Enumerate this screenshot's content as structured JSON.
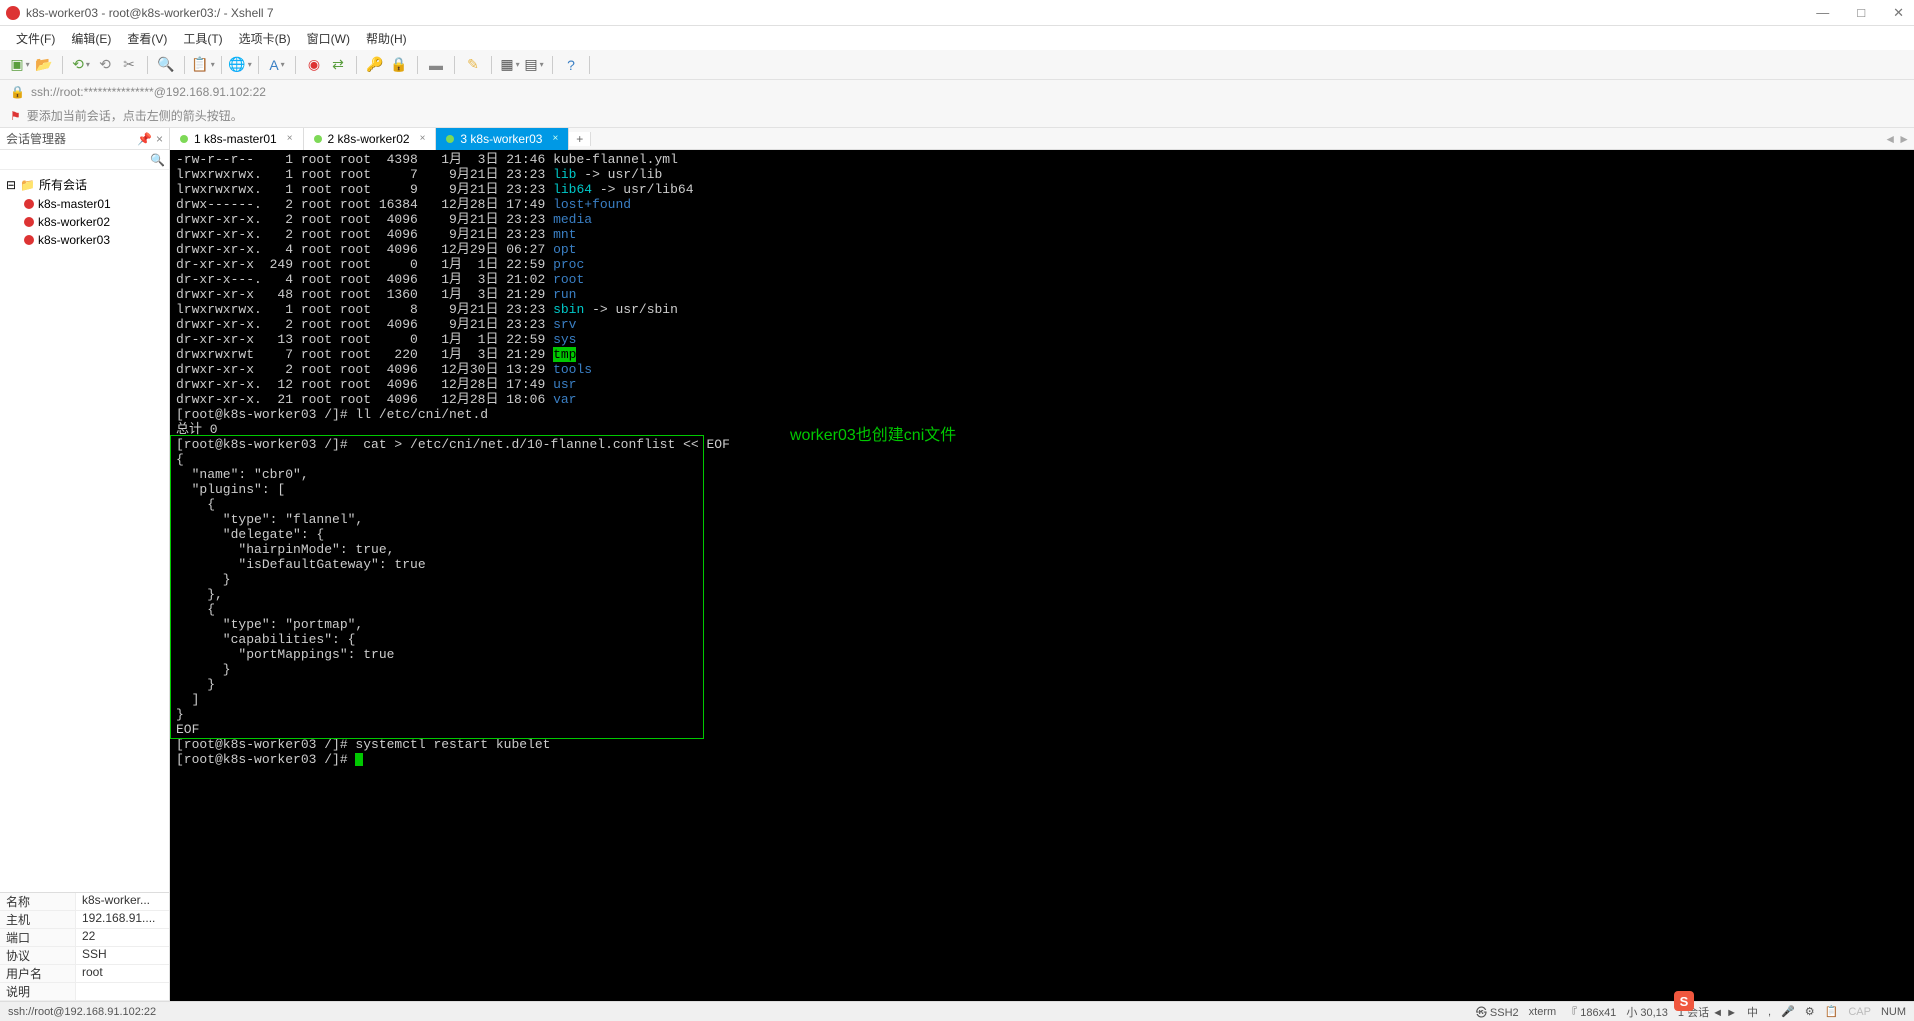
{
  "window": {
    "title": "k8s-worker03 - root@k8s-worker03:/ - Xshell 7",
    "min": "—",
    "max": "□",
    "close": "✕"
  },
  "menus": [
    "文件(F)",
    "编辑(E)",
    "查看(V)",
    "工具(T)",
    "选项卡(B)",
    "窗口(W)",
    "帮助(H)"
  ],
  "address": "ssh://root:***************@192.168.91.102:22",
  "hint": "要添加当前会话，点击左侧的箭头按钮。",
  "sidebar": {
    "title": "会话管理器",
    "root": "所有会话",
    "hosts": [
      "k8s-master01",
      "k8s-worker02",
      "k8s-worker03"
    ]
  },
  "props": [
    {
      "k": "名称",
      "v": "k8s-worker..."
    },
    {
      "k": "主机",
      "v": "192.168.91...."
    },
    {
      "k": "端口",
      "v": "22"
    },
    {
      "k": "协议",
      "v": "SSH"
    },
    {
      "k": "用户名",
      "v": "root"
    },
    {
      "k": "说明",
      "v": ""
    }
  ],
  "tabs": [
    {
      "num": "1",
      "label": "k8s-master01",
      "active": false
    },
    {
      "num": "2",
      "label": "k8s-worker02",
      "active": false
    },
    {
      "num": "3",
      "label": "k8s-worker03",
      "active": true
    }
  ],
  "annotation": "worker03也创建cni文件",
  "terminal": {
    "ls": [
      {
        "perm": "-rw-r--r--",
        "n": "1",
        "u": "root",
        "g": "root",
        "s": "4398",
        "d": "1月  3日 21:46",
        "name": "kube-flannel.yml",
        "col": "w"
      },
      {
        "perm": "lrwxrwxrwx.",
        "n": "1",
        "u": "root",
        "g": "root",
        "s": "7",
        "d": "9月21日 23:23",
        "name": "lib",
        "link": " -> usr/lib",
        "col": "c"
      },
      {
        "perm": "lrwxrwxrwx.",
        "n": "1",
        "u": "root",
        "g": "root",
        "s": "9",
        "d": "9月21日 23:23",
        "name": "lib64",
        "link": " -> usr/lib64",
        "col": "c"
      },
      {
        "perm": "drwx------.",
        "n": "2",
        "u": "root",
        "g": "root",
        "s": "16384",
        "d": "12月28日 17:49",
        "name": "lost+found",
        "col": "b"
      },
      {
        "perm": "drwxr-xr-x.",
        "n": "2",
        "u": "root",
        "g": "root",
        "s": "4096",
        "d": "9月21日 23:23",
        "name": "media",
        "col": "b"
      },
      {
        "perm": "drwxr-xr-x.",
        "n": "2",
        "u": "root",
        "g": "root",
        "s": "4096",
        "d": "9月21日 23:23",
        "name": "mnt",
        "col": "b"
      },
      {
        "perm": "drwxr-xr-x.",
        "n": "4",
        "u": "root",
        "g": "root",
        "s": "4096",
        "d": "12月29日 06:27",
        "name": "opt",
        "col": "b"
      },
      {
        "perm": "dr-xr-xr-x",
        "n": "249",
        "u": "root",
        "g": "root",
        "s": "0",
        "d": "1月  1日 22:59",
        "name": "proc",
        "col": "b"
      },
      {
        "perm": "dr-xr-x---.",
        "n": "4",
        "u": "root",
        "g": "root",
        "s": "4096",
        "d": "1月  3日 21:02",
        "name": "root",
        "col": "b"
      },
      {
        "perm": "drwxr-xr-x",
        "n": "48",
        "u": "root",
        "g": "root",
        "s": "1360",
        "d": "1月  3日 21:29",
        "name": "run",
        "col": "b"
      },
      {
        "perm": "lrwxrwxrwx.",
        "n": "1",
        "u": "root",
        "g": "root",
        "s": "8",
        "d": "9月21日 23:23",
        "name": "sbin",
        "link": " -> usr/sbin",
        "col": "c"
      },
      {
        "perm": "drwxr-xr-x.",
        "n": "2",
        "u": "root",
        "g": "root",
        "s": "4096",
        "d": "9月21日 23:23",
        "name": "srv",
        "col": "b"
      },
      {
        "perm": "dr-xr-xr-x",
        "n": "13",
        "u": "root",
        "g": "root",
        "s": "0",
        "d": "1月  1日 22:59",
        "name": "sys",
        "col": "b"
      },
      {
        "perm": "drwxrwxrwt",
        "n": "7",
        "u": "root",
        "g": "root",
        "s": "220",
        "d": "1月  3日 21:29",
        "name": "tmp",
        "col": "bg"
      },
      {
        "perm": "drwxr-xr-x",
        "n": "2",
        "u": "root",
        "g": "root",
        "s": "4096",
        "d": "12月30日 13:29",
        "name": "tools",
        "col": "b"
      },
      {
        "perm": "drwxr-xr-x.",
        "n": "12",
        "u": "root",
        "g": "root",
        "s": "4096",
        "d": "12月28日 17:49",
        "name": "usr",
        "col": "b"
      },
      {
        "perm": "drwxr-xr-x.",
        "n": "21",
        "u": "root",
        "g": "root",
        "s": "4096",
        "d": "12月28日 18:06",
        "name": "var",
        "col": "b"
      }
    ],
    "cmd1": "[root@k8s-worker03 /]# ll /etc/cni/net.d",
    "total": "总计 0",
    "cmd2": "[root@k8s-worker03 /]#  cat > /etc/cni/net.d/10-flannel.conflist << EOF",
    "body": "{\n  \"name\": \"cbr0\",\n  \"plugins\": [\n    {\n      \"type\": \"flannel\",\n      \"delegate\": {\n        \"hairpinMode\": true,\n        \"isDefaultGateway\": true\n      }\n    },\n    {\n      \"type\": \"portmap\",\n      \"capabilities\": {\n        \"portMappings\": true\n      }\n    }\n  ]\n}\nEOF",
    "cmd3": "[root@k8s-worker03 /]# systemctl restart kubelet",
    "cmd4": "[root@k8s-worker03 /]# "
  },
  "status": {
    "left": "ssh://root@192.168.91.102:22",
    "items": [
      "㉿ SSH2",
      "xterm",
      "『 186x41",
      "小 30,13",
      "1 会话 ◄ ►"
    ],
    "ime_items": [
      "中",
      ",",
      "🎤",
      "⚙",
      "📋"
    ],
    "cap": "CAP",
    "num": "NUM"
  }
}
